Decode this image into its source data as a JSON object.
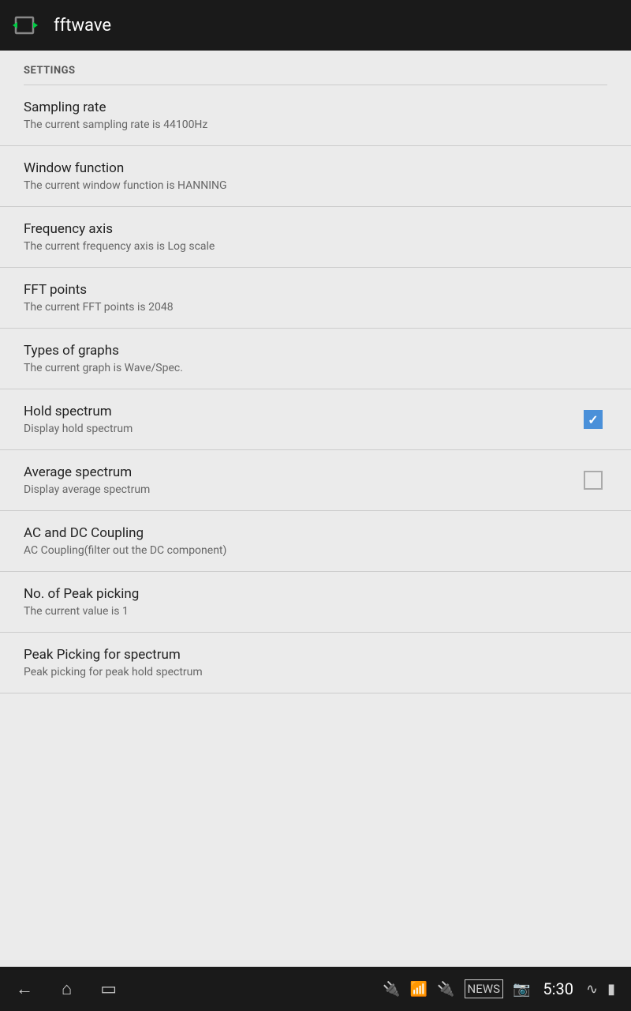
{
  "app": {
    "title": "fftwave"
  },
  "settings": {
    "header": "SETTINGS",
    "items": [
      {
        "id": "sampling-rate",
        "title": "Sampling rate",
        "subtitle": "The current sampling rate is 44100Hz",
        "has_checkbox": false
      },
      {
        "id": "window-function",
        "title": "Window function",
        "subtitle": "The current window function is HANNING",
        "has_checkbox": false
      },
      {
        "id": "frequency-axis",
        "title": "Frequency axis",
        "subtitle": "The current frequency axis is Log scale",
        "has_checkbox": false
      },
      {
        "id": "fft-points",
        "title": "FFT points",
        "subtitle": "The current FFT points is 2048",
        "has_checkbox": false
      },
      {
        "id": "types-of-graphs",
        "title": "Types of graphs",
        "subtitle": "The current graph is Wave/Spec.",
        "has_checkbox": false
      },
      {
        "id": "hold-spectrum",
        "title": "Hold spectrum",
        "subtitle": "Display hold spectrum",
        "has_checkbox": true,
        "checked": true
      },
      {
        "id": "average-spectrum",
        "title": "Average spectrum",
        "subtitle": "Display average spectrum",
        "has_checkbox": true,
        "checked": false
      },
      {
        "id": "ac-dc-coupling",
        "title": "AC and DC Coupling",
        "subtitle": "AC Coupling(filter out the DC component)",
        "has_checkbox": false
      },
      {
        "id": "no-peak-picking",
        "title": "No. of Peak picking",
        "subtitle": "The current value is 1",
        "has_checkbox": false
      },
      {
        "id": "peak-picking-spectrum",
        "title": "Peak Picking for spectrum",
        "subtitle": "Peak picking for peak hold spectrum",
        "has_checkbox": false
      }
    ]
  },
  "statusbar": {
    "time": "5:30"
  }
}
